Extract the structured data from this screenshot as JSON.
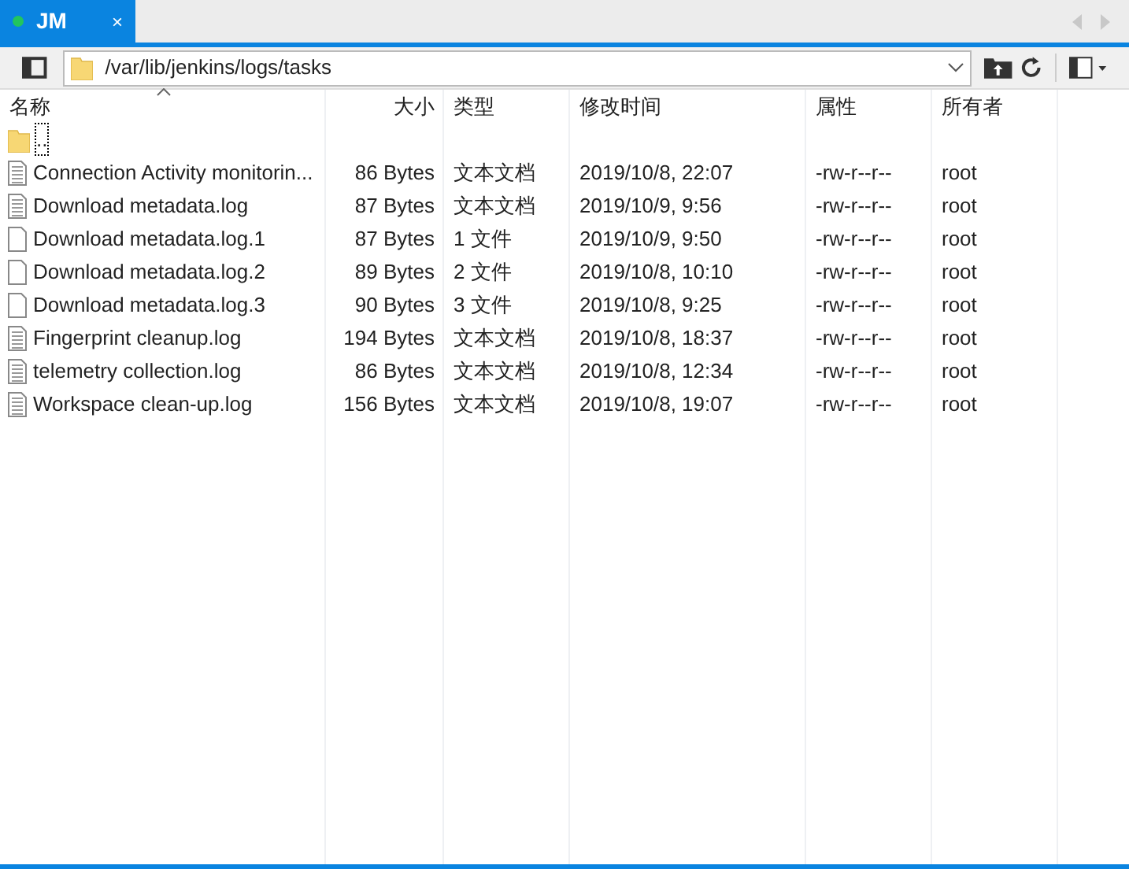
{
  "tab": {
    "label": "JM",
    "close": "×"
  },
  "address": {
    "value": "/var/lib/jenkins/logs/tasks"
  },
  "columns": [
    {
      "label": "名称",
      "sorted": true
    },
    {
      "label": "大小",
      "sorted": false
    },
    {
      "label": "类型",
      "sorted": false
    },
    {
      "label": "修改时间",
      "sorted": false
    },
    {
      "label": "属性",
      "sorted": false
    },
    {
      "label": "所有者",
      "sorted": false
    }
  ],
  "rows": [
    {
      "kind": "parent",
      "name": "..",
      "selected": true
    },
    {
      "kind": "text",
      "name": "Connection Activity monitorin...",
      "size": "86 Bytes",
      "type": "文本文档",
      "modified": "2019/10/8, 22:07",
      "attributes": "-rw-r--r--",
      "owner": "root"
    },
    {
      "kind": "text",
      "name": "Download metadata.log",
      "size": "87 Bytes",
      "type": "文本文档",
      "modified": "2019/10/9, 9:56",
      "attributes": "-rw-r--r--",
      "owner": "root"
    },
    {
      "kind": "plain",
      "name": "Download metadata.log.1",
      "size": "87 Bytes",
      "type": "1 文件",
      "modified": "2019/10/9, 9:50",
      "attributes": "-rw-r--r--",
      "owner": "root"
    },
    {
      "kind": "plain",
      "name": "Download metadata.log.2",
      "size": "89 Bytes",
      "type": "2 文件",
      "modified": "2019/10/8, 10:10",
      "attributes": "-rw-r--r--",
      "owner": "root"
    },
    {
      "kind": "plain",
      "name": "Download metadata.log.3",
      "size": "90 Bytes",
      "type": "3 文件",
      "modified": "2019/10/8, 9:25",
      "attributes": "-rw-r--r--",
      "owner": "root"
    },
    {
      "kind": "text",
      "name": "Fingerprint cleanup.log",
      "size": "194 Bytes",
      "type": "文本文档",
      "modified": "2019/10/8, 18:37",
      "attributes": "-rw-r--r--",
      "owner": "root"
    },
    {
      "kind": "text",
      "name": "telemetry collection.log",
      "size": "86 Bytes",
      "type": "文本文档",
      "modified": "2019/10/8, 12:34",
      "attributes": "-rw-r--r--",
      "owner": "root"
    },
    {
      "kind": "text",
      "name": "Workspace clean-up.log",
      "size": "156 Bytes",
      "type": "文本文档",
      "modified": "2019/10/8, 19:07",
      "attributes": "-rw-r--r--",
      "owner": "root"
    }
  ]
}
